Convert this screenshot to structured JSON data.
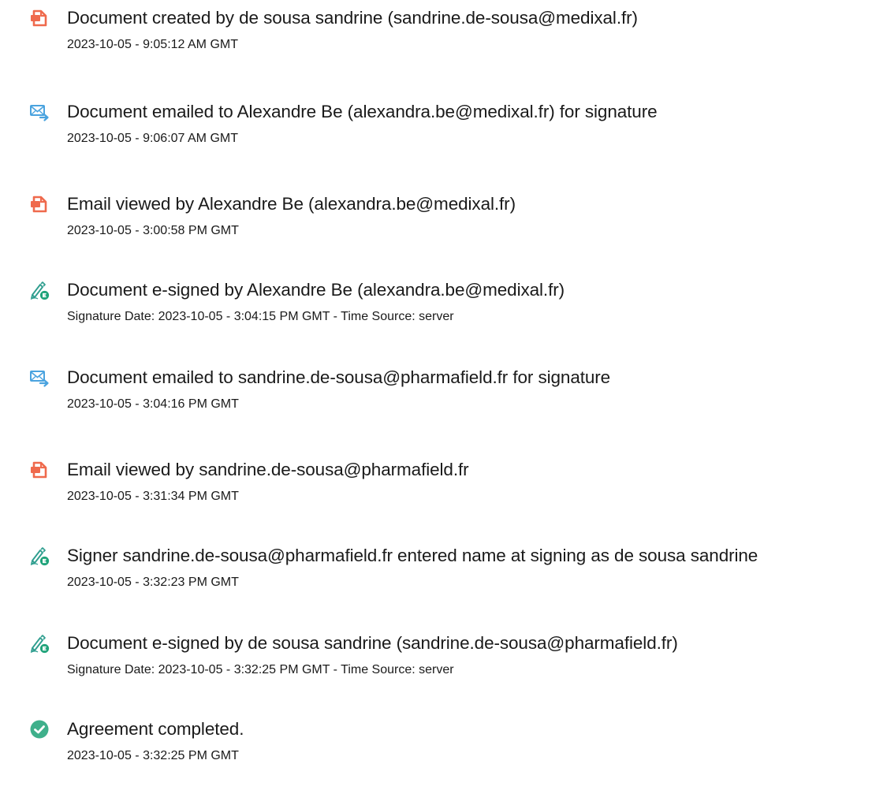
{
  "colors": {
    "document_icon": "#ef6a4d",
    "email_icon": "#4aa3df",
    "sign_icon": "#2f9e8f",
    "sign_badge": "#1fa37a",
    "complete_icon": "#3fb08b",
    "text": "#1a1a1a"
  },
  "events": [
    {
      "icon": "document-icon",
      "title": "Document created by de sousa sandrine (sandrine.de-sousa@medixal.fr)",
      "time": "2023-10-05 - 9:05:12 AM GMT"
    },
    {
      "icon": "email-icon",
      "title": "Document emailed to Alexandre Be (alexandra.be@medixal.fr) for signature",
      "time": "2023-10-05 - 9:06:07 AM GMT"
    },
    {
      "icon": "document-icon",
      "title": "Email viewed by Alexandre Be (alexandra.be@medixal.fr)",
      "time": "2023-10-05 - 3:00:58 PM GMT"
    },
    {
      "icon": "e-sign-icon",
      "title": "Document e-signed by Alexandre Be (alexandra.be@medixal.fr)",
      "time": "Signature Date: 2023-10-05 - 3:04:15 PM GMT - Time Source: server"
    },
    {
      "icon": "email-icon",
      "title": "Document emailed to sandrine.de-sousa@pharmafield.fr for signature",
      "time": "2023-10-05 - 3:04:16 PM GMT"
    },
    {
      "icon": "document-icon",
      "title": "Email viewed by sandrine.de-sousa@pharmafield.fr",
      "time": "2023-10-05 - 3:31:34 PM GMT"
    },
    {
      "icon": "e-sign-icon",
      "title": "Signer sandrine.de-sousa@pharmafield.fr entered name at signing as de sousa sandrine",
      "time": "2023-10-05 - 3:32:23 PM GMT"
    },
    {
      "icon": "e-sign-icon",
      "title": "Document e-signed by de sousa sandrine (sandrine.de-sousa@pharmafield.fr)",
      "time": "Signature Date: 2023-10-05 - 3:32:25 PM GMT - Time Source: server"
    },
    {
      "icon": "check-circle-icon",
      "title": "Agreement completed.",
      "time": "2023-10-05 - 3:32:25 PM GMT"
    }
  ]
}
